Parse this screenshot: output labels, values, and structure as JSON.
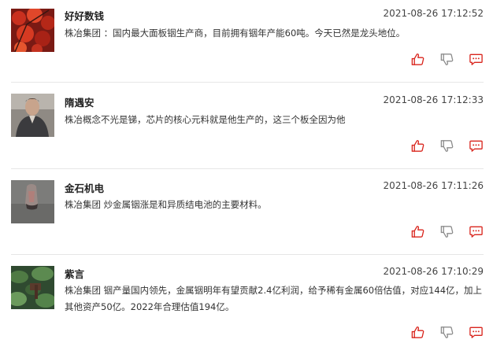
{
  "posts": [
    {
      "username": "好好数钱",
      "timestamp": "2021-08-26 17:12:52",
      "stock_tag": "株冶集团",
      "text": "：国内最大面板铟生产商，目前拥有铟年产能60吨。今天已然是龙头地位。"
    },
    {
      "username": "隋遇安",
      "timestamp": "2021-08-26 17:12:33",
      "stock_tag": "",
      "text": "株冶概念不光是锑，芯片的核心元料就是他生产的，这三个板全因为他"
    },
    {
      "username": "金石机电",
      "timestamp": "2021-08-26 17:11:26",
      "stock_tag": "株冶集团",
      "text": "炒金属铟涨是和异质结电池的主要材料。"
    },
    {
      "username": "紫言",
      "timestamp": "2021-08-26 17:10:29",
      "stock_tag": "株冶集团",
      "text": "铟产量国内领先，金属铟明年有望贡献2.4亿利润，给予稀有金属60倍估值，对应144亿，加上其他资产50亿。2022年合理估值194亿。"
    }
  ],
  "icons": {
    "like": "thumbs-up-icon",
    "dislike": "thumbs-down-icon",
    "comment": "comment-icon"
  },
  "colors": {
    "accent": "#d9251d",
    "dislike": "#8c8c8c",
    "divider": "#e6e6e6"
  }
}
